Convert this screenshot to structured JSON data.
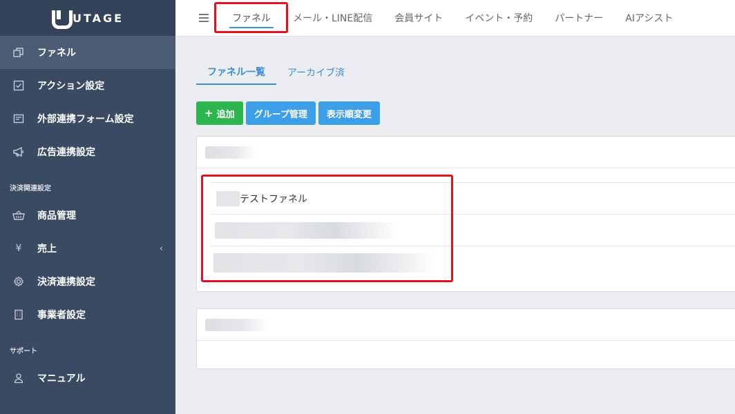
{
  "app": {
    "brand": "UTAGE"
  },
  "sidebar": {
    "items": [
      {
        "label": "ファネル",
        "icon": "copy-icon",
        "active": true
      },
      {
        "label": "アクション設定",
        "icon": "checklist-icon"
      },
      {
        "label": "外部連携フォーム設定",
        "icon": "form-icon"
      },
      {
        "label": "広告連携設定",
        "icon": "megaphone-icon"
      }
    ],
    "section_payment": "決済関連設定",
    "payment_items": [
      {
        "label": "商品管理",
        "icon": "basket-icon"
      },
      {
        "label": "売上",
        "icon": "yen-icon",
        "chevron": "‹"
      },
      {
        "label": "決済連携設定",
        "icon": "gear-icon"
      },
      {
        "label": "事業者設定",
        "icon": "building-icon"
      }
    ],
    "section_support": "サポート",
    "support_items": [
      {
        "label": "マニュアル",
        "icon": "user-icon"
      }
    ]
  },
  "topnav": {
    "tabs": [
      {
        "label": "ファネル",
        "active": true
      },
      {
        "label": "メール・LINE配信"
      },
      {
        "label": "会員サイト"
      },
      {
        "label": "イベント・予約"
      },
      {
        "label": "パートナー"
      },
      {
        "label": "AIアシスト"
      }
    ]
  },
  "subtabs": [
    {
      "label": "ファネル一覧",
      "active": true
    },
    {
      "label": "アーカイブ済"
    }
  ],
  "buttons": {
    "add": "追加",
    "group": "グループ管理",
    "order": "表示順変更"
  },
  "funnel_list": {
    "rows": [
      {
        "label": "テストファネル"
      }
    ]
  },
  "colors": {
    "sidebar_bg": "#3b4a63",
    "accent_blue": "#3c8dd6",
    "add_green": "#2cb550",
    "button_blue": "#3d9eea",
    "highlight_red": "#e0141e"
  }
}
